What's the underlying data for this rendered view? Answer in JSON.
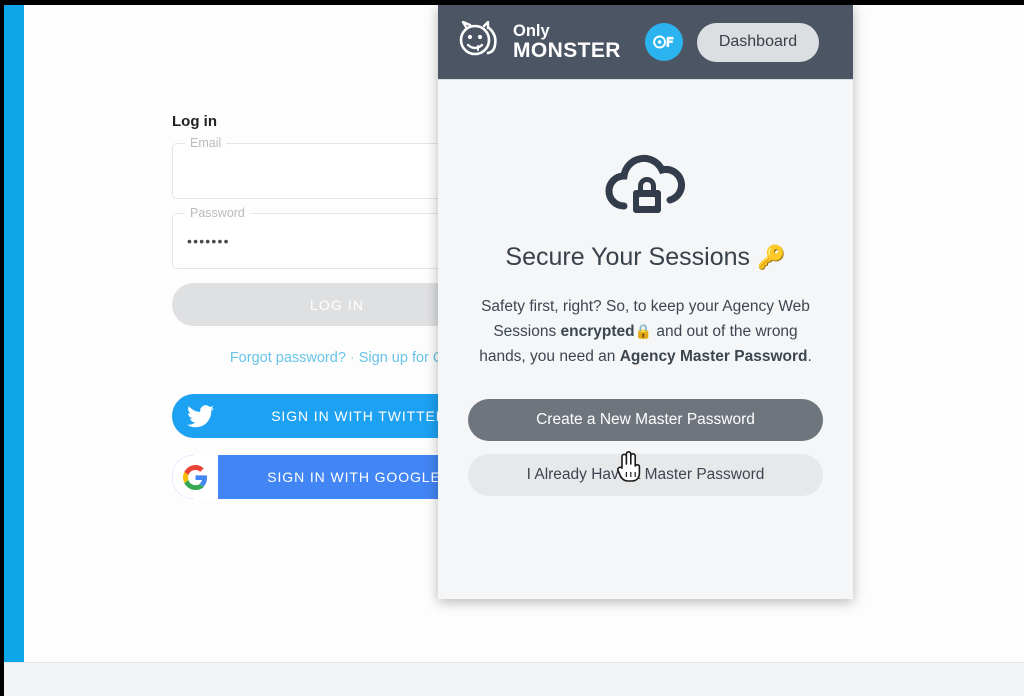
{
  "login": {
    "title": "Log in",
    "email": {
      "label": "Email",
      "value": "",
      "placeholder": "Email"
    },
    "password": {
      "label": "Password",
      "value": "•••••••",
      "placeholder": "Password"
    },
    "submit_label": "LOG IN",
    "forgot_label": "Forgot password?",
    "separator": "·",
    "signup_label": "Sign up for O",
    "twitter_label": "SIGN IN WITH TWITTER",
    "google_label": "SIGN IN WITH GOOGLE"
  },
  "panel": {
    "brand": {
      "line1": "Only",
      "line2": "MONSTER"
    },
    "of_badge_icon": "onlyfans-icon",
    "dashboard_label": "Dashboard",
    "hero_icon": "cloud-lock-icon",
    "heading": "Secure Your Sessions",
    "heading_emoji": "🔑",
    "paragraph": {
      "part1": "Safety first, right? So, to keep your Agency Web Sessions ",
      "bold1": "encrypted",
      "emoji1": "🔒",
      "part2": " and out of the wrong hands, you need an ",
      "bold2": "Agency Master Password",
      "part3": "."
    },
    "primary_button": "Create a New Master Password",
    "secondary_button": "I Already Have a Master Password"
  },
  "colors": {
    "header_bg": "#4b5563",
    "panel_bg": "#f4f6f8",
    "accent_cyan": "#2bb3ef",
    "twitter_blue": "#1da1f2",
    "google_blue": "#4285f4",
    "link_blue": "#67c3e8",
    "primary_btn": "#6f757d",
    "page_strip": "#0fa6e9"
  }
}
